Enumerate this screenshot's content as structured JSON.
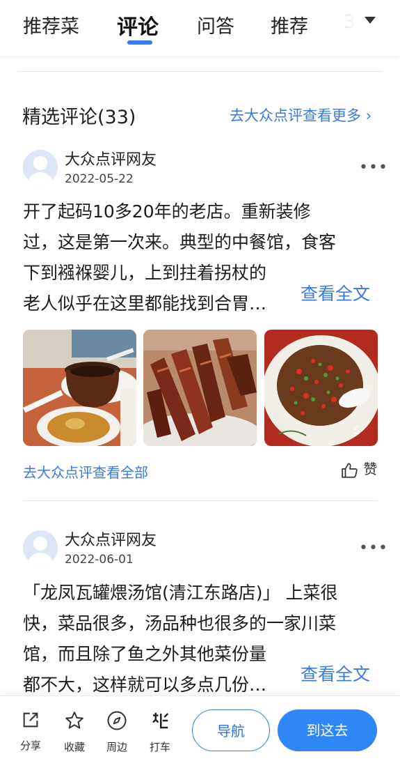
{
  "tabs": [
    {
      "label": "推荐菜",
      "active": false
    },
    {
      "label": "评论",
      "active": true
    },
    {
      "label": "问答",
      "active": false
    },
    {
      "label": "推荐",
      "active": false
    },
    {
      "label": "3",
      "active": false
    }
  ],
  "section": {
    "title": "精选评论(33)",
    "more_link": "去大众点评查看更多",
    "more_chevron": "›"
  },
  "reviews": [
    {
      "user": "大众点评网友",
      "date": "2022-05-22",
      "more": "•••",
      "lines": [
        "开了起码10多20年的老店。重新装修",
        "过，这是第一次来。典型的中餐馆，食客",
        "下到襁褓婴儿，上到拄着拐杖的",
        "老人似乎在这里都能找到合胃…"
      ],
      "read_full": "查看全文",
      "photo_badge": "5",
      "go_all": "去大众点评查看全部",
      "like": "赞"
    },
    {
      "user": "大众点评网友",
      "date": "2022-06-01",
      "more": "•••",
      "lines": [
        "「龙凤瓦罐煨汤馆(清江东路店)」 上菜很",
        "快，菜品很多，汤品种也很多的一家川菜",
        "馆，而且除了鱼之外其他菜份量",
        "都不大，这样就可以多点几份…"
      ],
      "read_full": "查看全文"
    }
  ],
  "bottom_bar": {
    "share": "分享",
    "collect": "收藏",
    "nearby": "周边",
    "taxi": "打车",
    "navigate": "导航",
    "go_there": "到这去"
  },
  "colors": {
    "accent": "#2f86f6",
    "link": "#3b7bd6"
  }
}
